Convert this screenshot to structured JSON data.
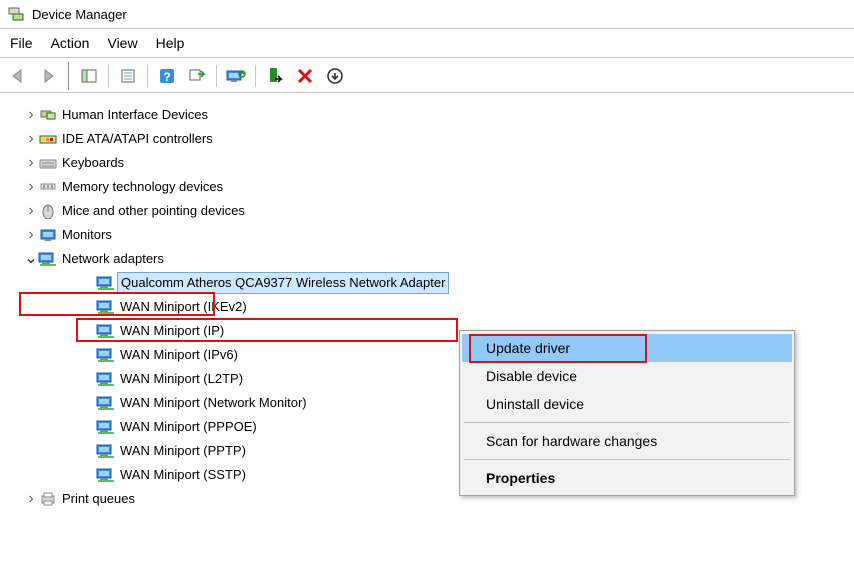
{
  "window": {
    "title": "Device Manager"
  },
  "menu": {
    "file": "File",
    "action": "Action",
    "view": "View",
    "help": "Help"
  },
  "tree": {
    "items": [
      {
        "label": "Human Interface Devices",
        "icon": "hid",
        "expanded": false,
        "depth": 1
      },
      {
        "label": "IDE ATA/ATAPI controllers",
        "icon": "ide",
        "expanded": false,
        "depth": 1
      },
      {
        "label": "Keyboards",
        "icon": "keyboard",
        "expanded": false,
        "depth": 1
      },
      {
        "label": "Memory technology devices",
        "icon": "memory",
        "expanded": false,
        "depth": 1
      },
      {
        "label": "Mice and other pointing devices",
        "icon": "mouse",
        "expanded": false,
        "depth": 1
      },
      {
        "label": "Monitors",
        "icon": "monitor",
        "expanded": false,
        "depth": 1
      },
      {
        "label": "Network adapters",
        "icon": "net",
        "expanded": true,
        "depth": 1,
        "annotated": true
      },
      {
        "label": "Qualcomm Atheros QCA9377 Wireless Network Adapter",
        "icon": "net",
        "depth": 2,
        "selected": true,
        "annotated": true
      },
      {
        "label": "WAN Miniport (IKEv2)",
        "icon": "net",
        "depth": 2
      },
      {
        "label": "WAN Miniport (IP)",
        "icon": "net",
        "depth": 2
      },
      {
        "label": "WAN Miniport (IPv6)",
        "icon": "net",
        "depth": 2
      },
      {
        "label": "WAN Miniport (L2TP)",
        "icon": "net",
        "depth": 2
      },
      {
        "label": "WAN Miniport (Network Monitor)",
        "icon": "net",
        "depth": 2
      },
      {
        "label": "WAN Miniport (PPPOE)",
        "icon": "net",
        "depth": 2
      },
      {
        "label": "WAN Miniport (PPTP)",
        "icon": "net",
        "depth": 2
      },
      {
        "label": "WAN Miniport (SSTP)",
        "icon": "net",
        "depth": 2
      },
      {
        "label": "Print queues",
        "icon": "printer",
        "expanded": false,
        "depth": 1
      }
    ]
  },
  "context_menu": {
    "update": "Update driver",
    "disable": "Disable device",
    "uninstall": "Uninstall device",
    "scan": "Scan for hardware changes",
    "properties": "Properties"
  }
}
